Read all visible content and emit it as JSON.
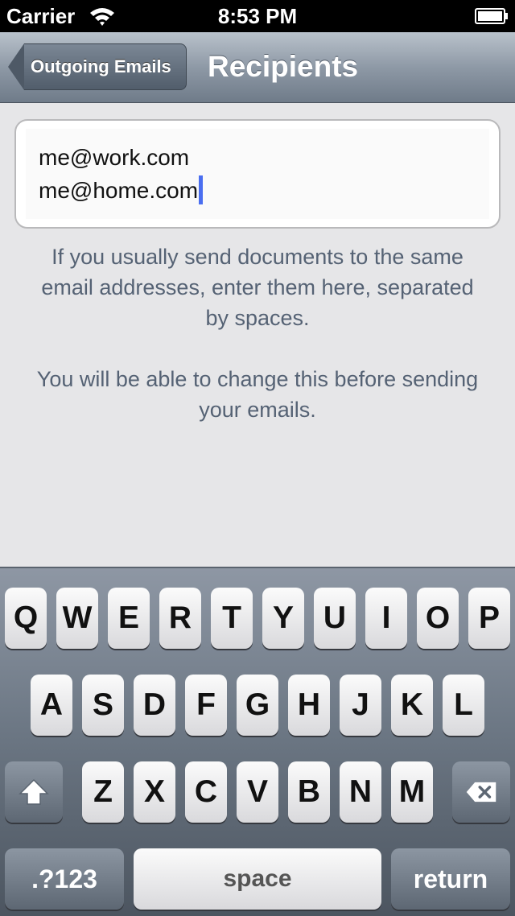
{
  "status_bar": {
    "carrier": "Carrier",
    "time": "8:53 PM",
    "icons": [
      "wifi-icon",
      "battery-icon"
    ]
  },
  "nav": {
    "back_label": "Outgoing Emails",
    "title": "Recipients"
  },
  "recipients_field": {
    "lines": [
      "me@work.com",
      "me@home.com"
    ]
  },
  "help": {
    "paragraph_1": "If you usually send documents to the same email addresses, enter them here, separated by spaces.",
    "paragraph_2": "You will be able to change this before sending your emails."
  },
  "keyboard": {
    "row1": [
      "Q",
      "W",
      "E",
      "R",
      "T",
      "Y",
      "U",
      "I",
      "O",
      "P"
    ],
    "row2": [
      "A",
      "S",
      "D",
      "F",
      "G",
      "H",
      "J",
      "K",
      "L"
    ],
    "row3": [
      "Z",
      "X",
      "C",
      "V",
      "B",
      "N",
      "M"
    ],
    "numbers_label": ".?123",
    "space_label": "space",
    "return_label": "return",
    "shift_icon": "shift-icon",
    "delete_icon": "delete-icon"
  },
  "colors": {
    "cursor": "#4a6ef0",
    "help_text": "#556274"
  }
}
